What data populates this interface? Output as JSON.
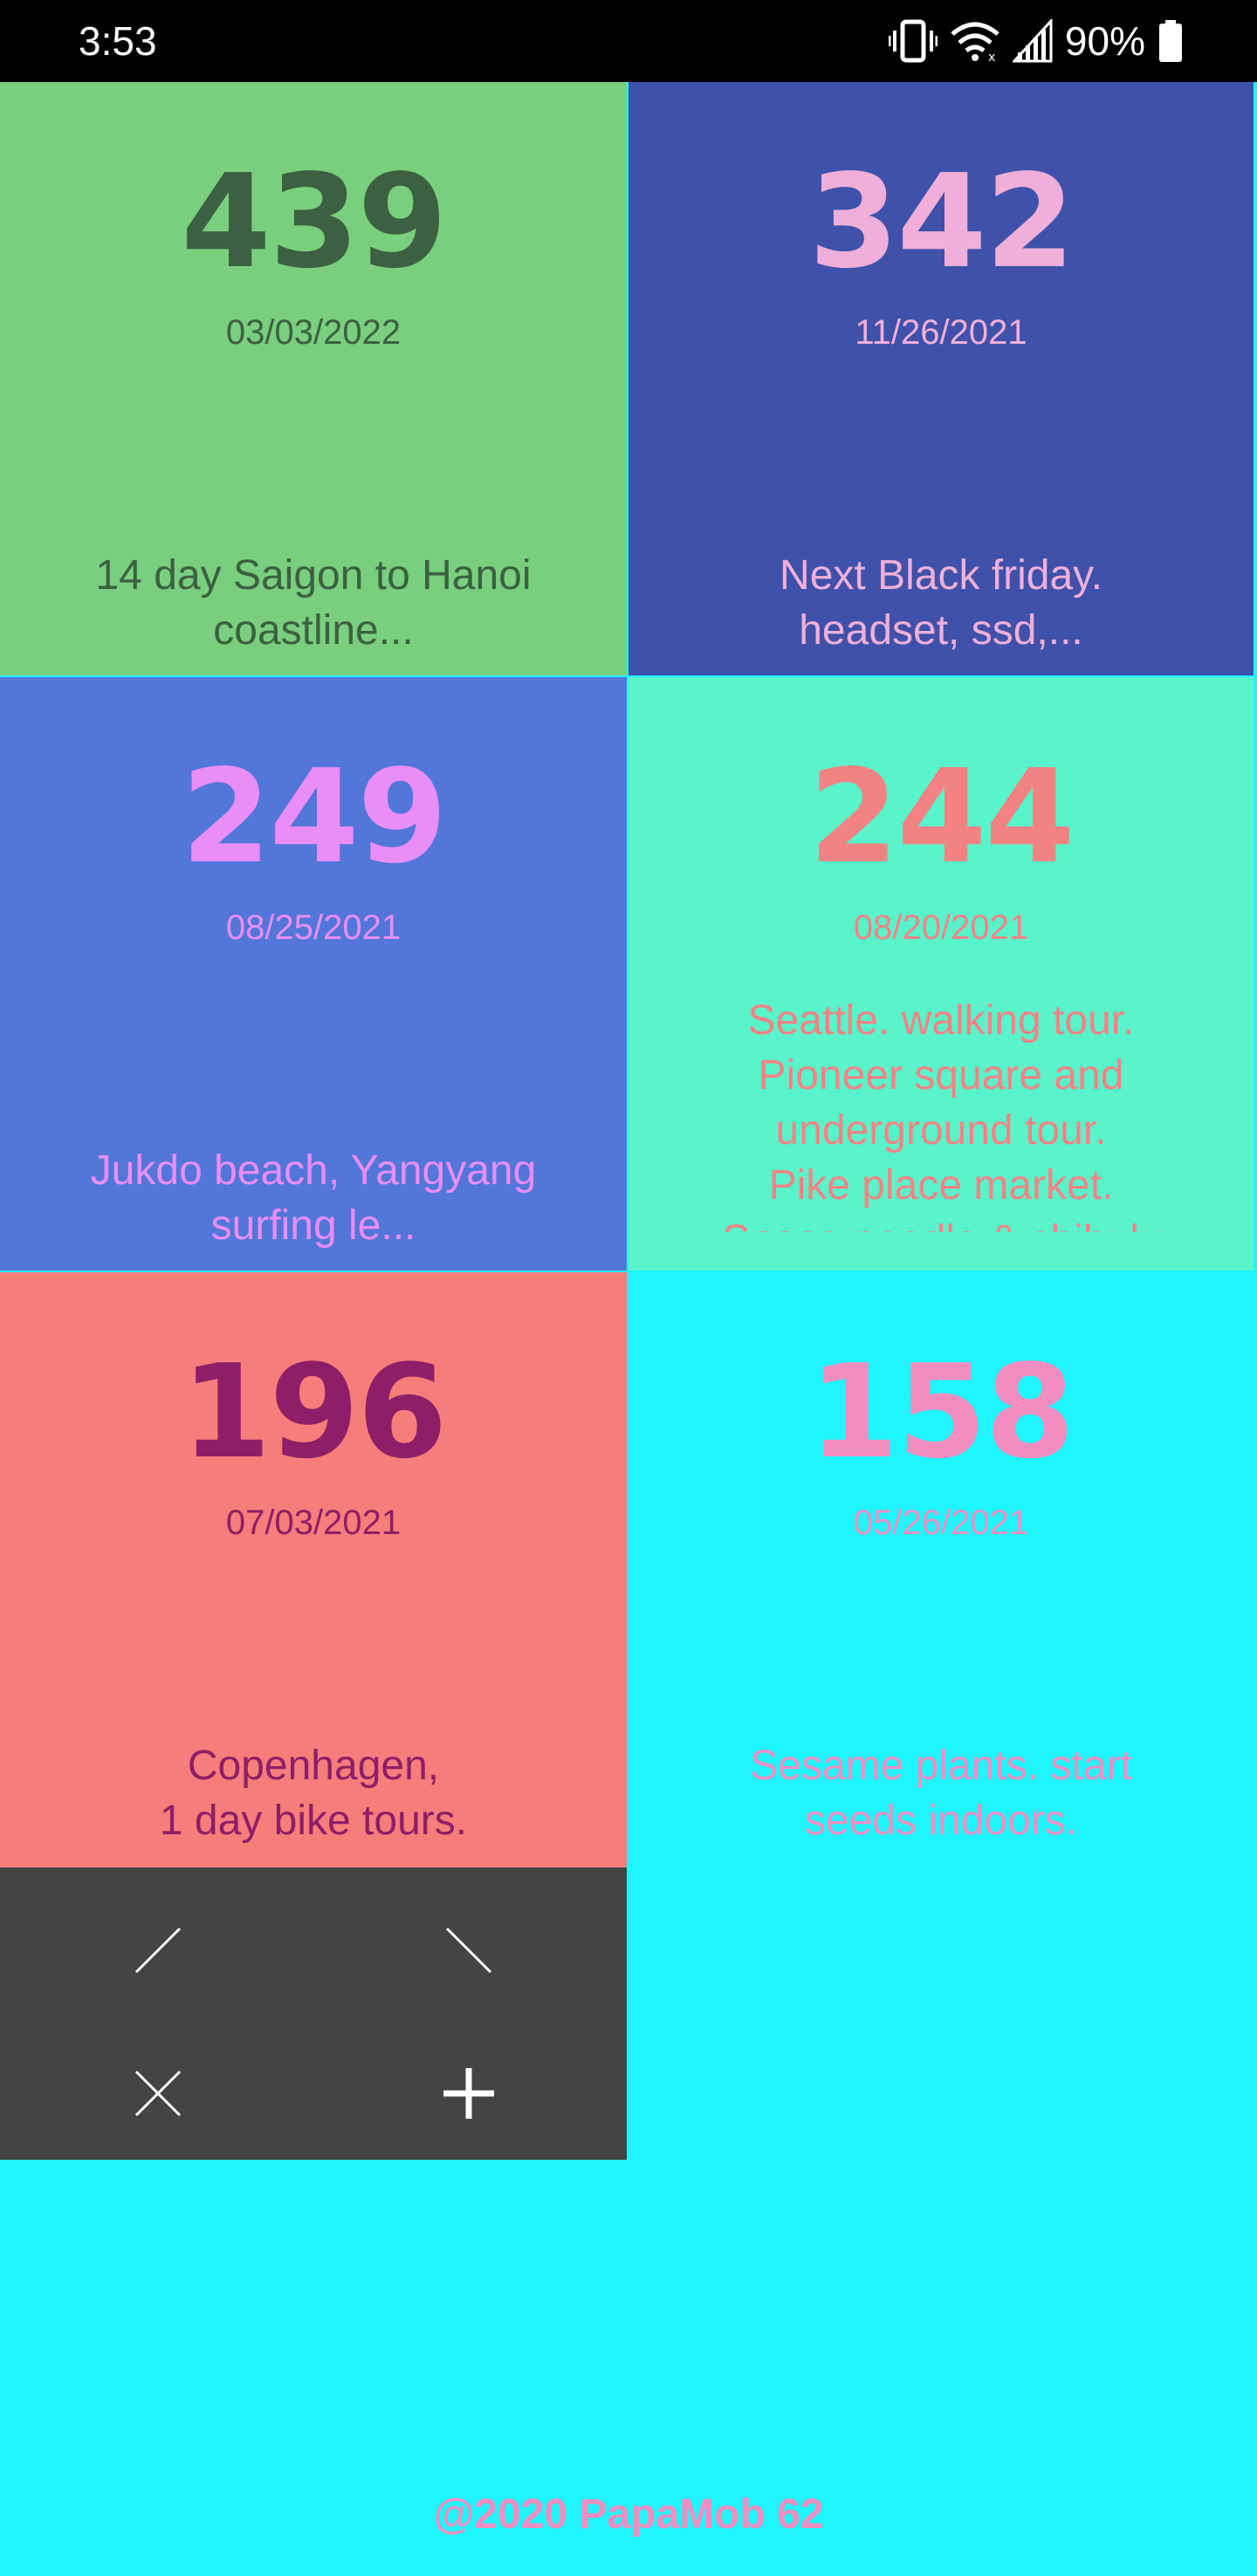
{
  "status_bar": {
    "time": "3:53",
    "battery_percent": "90%",
    "icons": [
      "vibrate-icon",
      "wifi-icon",
      "signal-icon",
      "battery-icon"
    ]
  },
  "tiles": [
    {
      "number": "439",
      "date": "03/03/2022",
      "note": "14 day Saigon to Hanoi\ncoastline...",
      "bg": "#79cf7d",
      "fg": "#3c6041"
    },
    {
      "number": "342",
      "date": "11/26/2021",
      "note": "Next Black friday.\nheadset, ssd,...",
      "bg": "#3f51aa",
      "fg": "#f0afd8"
    },
    {
      "number": "249",
      "date": "08/25/2021",
      "note": "Jukdo beach, Yangyang\nsurfing le...",
      "bg": "#5276da",
      "fg": "#e98ef6"
    },
    {
      "number": "244",
      "date": "08/20/2021",
      "note": "Seattle. walking tour.\nPioneer square and\nunderground tour.\nPike place market.\nSpace needle & chihuly",
      "bg": "#59f4cc",
      "fg": "#f38382"
    },
    {
      "number": "196",
      "date": "07/03/2021",
      "note": "Copenhagen,\n1 day bike tours.",
      "bg": "#f77d7b",
      "fg": "#8e1e68"
    },
    {
      "number": "158",
      "date": "05/26/2021",
      "note": "Sesame plants. start\nseeds indoors.",
      "bg": "#1ff5fe",
      "fg": "#f28ebf"
    }
  ],
  "controls": {
    "bg": "#444444",
    "icons": [
      "line-up-icon",
      "line-down-icon",
      "close-icon",
      "add-icon"
    ]
  },
  "footer": {
    "text": "@2020 PapaMob 62",
    "color": "#f28ebf"
  }
}
